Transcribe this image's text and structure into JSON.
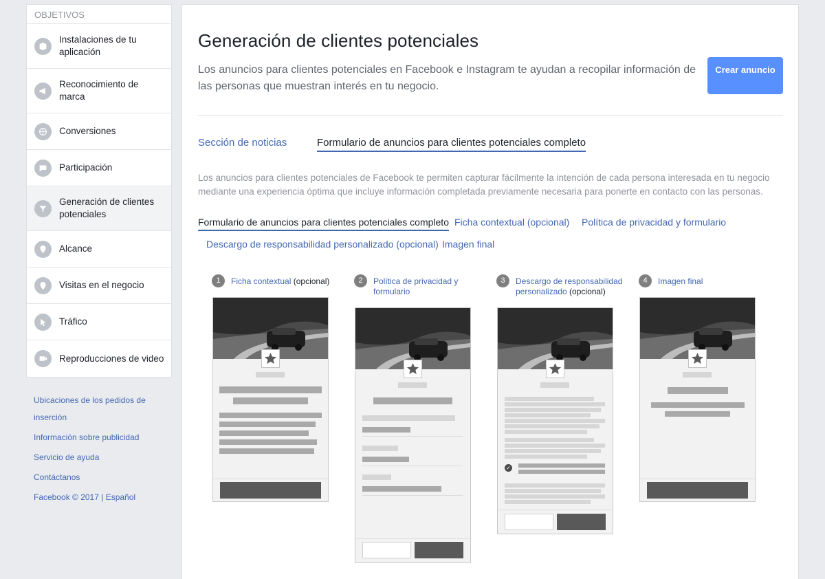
{
  "sidebar": {
    "header": "OBJETIVOS",
    "items": [
      {
        "label": "Instalaciones de tu aplicación",
        "icon": "cube-icon"
      },
      {
        "label": "Reconocimiento de marca",
        "icon": "megaphone-icon"
      },
      {
        "label": "Conversiones",
        "icon": "globe-icon"
      },
      {
        "label": "Participación",
        "icon": "chat-icon"
      },
      {
        "label": "Generación de clientes potenciales",
        "icon": "funnel-icon"
      },
      {
        "label": "Alcance",
        "icon": "location-icon"
      },
      {
        "label": "Visitas en el negocio",
        "icon": "store-pin-icon"
      },
      {
        "label": "Tráfico",
        "icon": "cursor-icon"
      },
      {
        "label": "Reproducciones de video",
        "icon": "video-camera-icon"
      }
    ]
  },
  "footer": {
    "links": [
      "Ubicaciones de los pedidos de inserción",
      "Información sobre publicidad",
      "Servicio de ayuda",
      "Contáctanos"
    ],
    "copyright": "Facebook © 2017 |",
    "language": "Español"
  },
  "main": {
    "title": "Generación de clientes potenciales",
    "subtitle": "Los anuncios para clientes potenciales en Facebook e Instagram te ayudan a recopilar información de las personas que muestran interés en tu negocio.",
    "create_button": "Crear anuncio",
    "tabs": [
      "Sección de noticias",
      "Formulario de anuncios para clientes potenciales completo"
    ],
    "description": "Los anuncios para clientes potenciales de Facebook te permiten capturar fácilmente la intención de cada persona interesada en tu negocio mediante una experiencia óptima que incluye información completada previamente necesaria para ponerte en contacto con las personas.",
    "subtabs": [
      "Formulario de anuncios para clientes potenciales completo",
      "Ficha contextual (opcional)",
      "Política de privacidad y formulario",
      "Descargo de responsabilidad personalizado (opcional)",
      "Imagen final"
    ],
    "steps": [
      {
        "num": "1",
        "link": "Ficha contextual",
        "suffix": " (opcional)"
      },
      {
        "num": "2",
        "link": "Política de privacidad y formulario",
        "suffix": ""
      },
      {
        "num": "3",
        "link": "Descargo de responsabilidad personalizado",
        "suffix": " (opcional)"
      },
      {
        "num": "4",
        "link": "Imagen final",
        "suffix": ""
      }
    ]
  }
}
